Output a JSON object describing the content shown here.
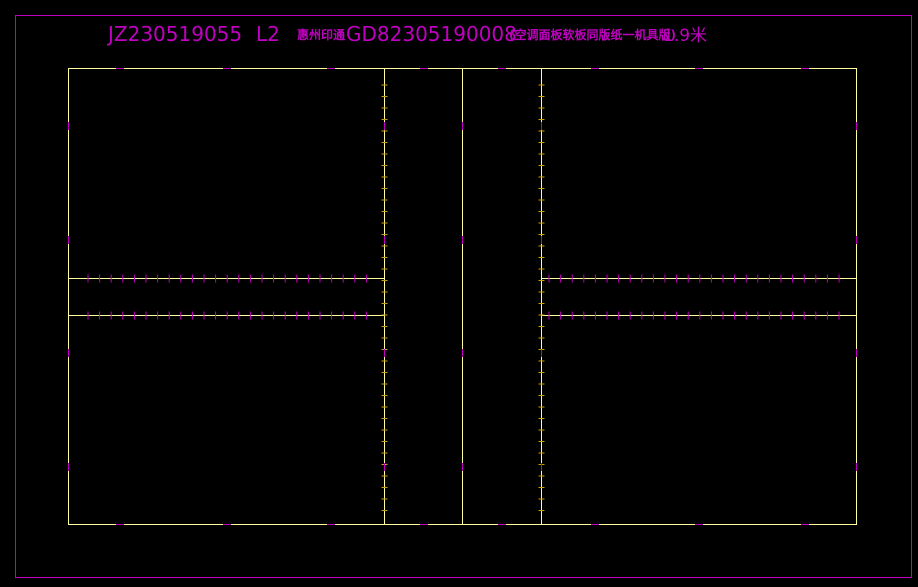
{
  "title": {
    "job_code": "JZ230519055",
    "layer": "L2",
    "customer": "惠州印通",
    "order_code": "GD82305190008",
    "note": "(空调面板软板同版纸一机具版)",
    "size": "1.9米"
  },
  "colors": {
    "background": "#000000",
    "outer_frame": "#c000c0",
    "panel_lines": "#ffffa0",
    "title_text": "#c000c0",
    "edge_marks": "#c000c0",
    "ruler_ticks_yellow": "#c8a000",
    "ruler_ticks_magenta": "#c000c0"
  }
}
